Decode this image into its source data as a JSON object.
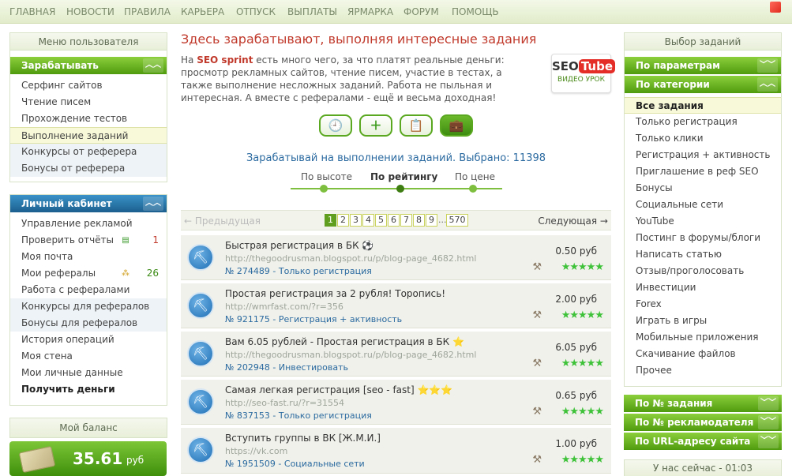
{
  "nav": {
    "items": [
      "ГЛАВНАЯ",
      "НОВОСТИ",
      "ПРАВИЛА",
      "КАРЬЕРА",
      "ОТПУСК",
      "ВЫПЛАТЫ",
      "ЯРМАРКА",
      "ФОРУМ",
      "ПОМОЩЬ"
    ]
  },
  "left": {
    "user_menu_title": "Меню пользователя",
    "earn_title": "Зарабатывать",
    "earn_items": [
      "Серфинг сайтов",
      "Чтение писем",
      "Прохождение тестов",
      "Выполнение заданий",
      "Конкурсы от реферера",
      "Бонусы от реферера"
    ],
    "cabinet_title": "Личный кабинет",
    "cabinet_items": [
      "Управление рекламой",
      "Проверить отчёты",
      "Моя почта",
      "Мои рефералы",
      "Работа с рефералами",
      "Конкурсы для рефералов",
      "Бонусы для рефералов",
      "История операций",
      "Моя стена",
      "Мои личные данные",
      "Получить деньги"
    ],
    "check_reports_count": "1",
    "referrals_count": "26",
    "balance_title": "Мой баланс",
    "balance_amount": "35.61",
    "balance_currency": "руб"
  },
  "main": {
    "title": "Здесь зарабатывают, выполняя интересные задания",
    "intro_prefix": "На ",
    "intro_brand": "SEO sprint",
    "intro_text": " есть много чего, за что платят реальные деньги: просмотр рекламных сайтов, чтение писем, участие в тестах, а также выполнение несложных заданий. Работа не пыльная и интересная. А вместе с рефералами - ещё и весьма доходная!",
    "seotube_seo": "SEO",
    "seotube_tube": "Tube",
    "seotube_sub": "ВИДЕО УРОК",
    "count_text": "Зарабатывай на выполнении заданий. Выбрано: 11398",
    "sort_options": [
      "По высоте",
      "По рейтингу",
      "По цене"
    ],
    "sort_selected": "По рейтингу",
    "pager": {
      "prev": "← Предыдущая",
      "next": "Следующая →",
      "pages": [
        "1",
        "2",
        "3",
        "4",
        "5",
        "6",
        "7",
        "8",
        "9"
      ],
      "dots": "...",
      "last": "570",
      "current": "1"
    },
    "tasks": [
      {
        "title": "Быстрая регистрация в БК ⚽",
        "url": "http://thegoodrusman.blogspot.ru/p/blog-page_4682.html",
        "meta": "№ 274489 - Только регистрация",
        "price": "0.50 руб",
        "rating": 5
      },
      {
        "title": "Простая регистрация за 2 рубля! Торопись!",
        "url": "http://wmrfast.com/?r=356",
        "meta": "№ 921175 - Регистрация + активность",
        "price": "2.00 руб",
        "rating": 5
      },
      {
        "title": "Вам 6.05 рублей - Простая регистрация в БК ⭐",
        "url": "http://thegoodrusman.blogspot.ru/p/blog-page_4682.html",
        "meta": "№ 202948 - Инвестировать",
        "price": "6.05 руб",
        "rating": 5
      },
      {
        "title": "Самая легкая регистрация [seo - fast] ⭐⭐⭐",
        "url": "http://seo-fast.ru/?r=31554",
        "meta": "№ 837153 - Только регистрация",
        "price": "0.65 руб",
        "rating": 5
      },
      {
        "title": "Вступить группы в ВК [Ж.М.И.]",
        "url": "https://vk.com",
        "meta": "№ 1951509 - Социальные сети",
        "price": "1.00 руб",
        "rating": 5
      }
    ]
  },
  "right": {
    "select_title": "Выбор заданий",
    "by_params": "По параметрам",
    "by_category": "По категории",
    "categories": [
      "Все задания",
      "Только регистрация",
      "Только клики",
      "Регистрация + активность",
      "Приглашение в реф SEO",
      "Бонусы",
      "Социальные сети",
      "YouTube",
      "Постинг в форумы/блоги",
      "Написать статью",
      "Отзыв/проголосовать",
      "Инвестиции",
      "Forex",
      "Играть в игры",
      "Мобильные приложения",
      "Скачивание файлов",
      "Прочее"
    ],
    "category_selected": "Все задания",
    "by_task_number": "По № задания",
    "by_advertiser": "По № рекламодателя",
    "by_url": "По URL-адресу сайта",
    "online_now": "У нас сейчас - 01:03"
  },
  "colors": {
    "accent_green": "#5aa820",
    "title_red": "#c0392b",
    "link_blue": "#2b6aa0"
  }
}
